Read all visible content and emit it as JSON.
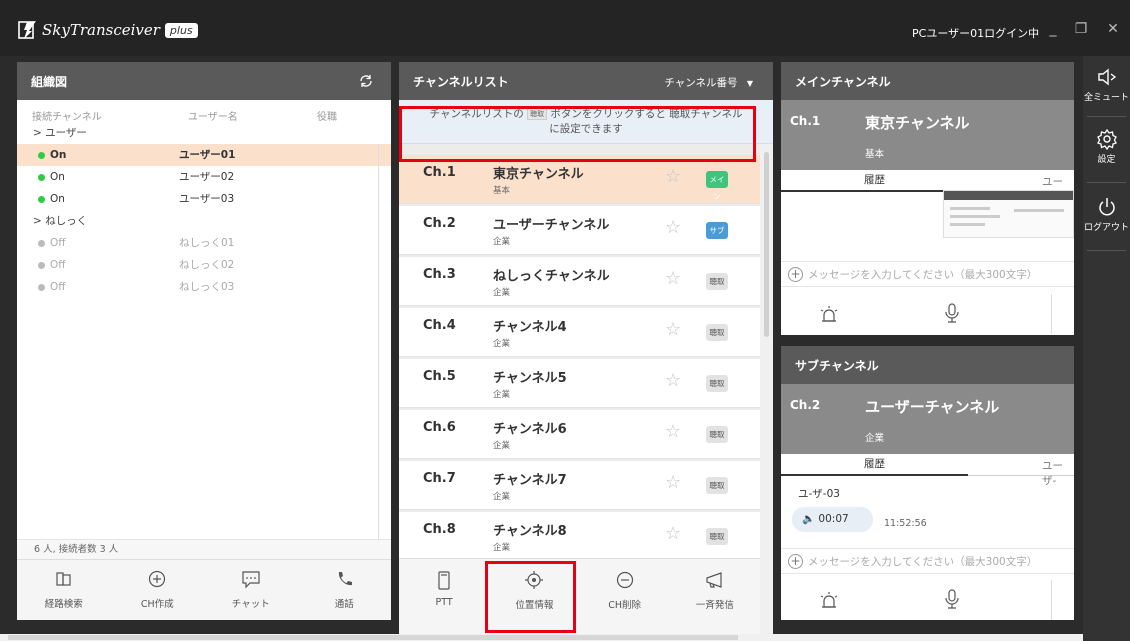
{
  "app": {
    "title": "SkyTransceiver",
    "edition": "plus",
    "login_status": "PCユーザー01ログイン中",
    "window_buttons": [
      "minimize-icon",
      "maximize-icon",
      "close-icon"
    ]
  },
  "org": {
    "title": "組織図",
    "columns": {
      "channel": "接続チャンネル",
      "user": "ユーザー名",
      "role": "役職"
    },
    "groups": [
      {
        "label": "ユーザー",
        "users": [
          {
            "status": "On",
            "name": "ユーザー01",
            "online": true,
            "selected": true
          },
          {
            "status": "On",
            "name": "ユーザー02",
            "online": true,
            "selected": false
          },
          {
            "status": "On",
            "name": "ユーザー03",
            "online": true,
            "selected": false
          }
        ]
      },
      {
        "label": "ねしっく",
        "users": [
          {
            "status": "Off",
            "name": "ねしっく01",
            "online": false,
            "selected": false
          },
          {
            "status": "Off",
            "name": "ねしっく02",
            "online": false,
            "selected": false
          },
          {
            "status": "Off",
            "name": "ねしっく03",
            "online": false,
            "selected": false
          }
        ]
      }
    ],
    "count_text": "6 人, 接続者数 3 人",
    "toolbar": [
      {
        "label": "経路検索",
        "icon": "route-search-icon"
      },
      {
        "label": "CH作成",
        "icon": "add-circle-icon"
      },
      {
        "label": "チャット",
        "icon": "chat-icon"
      },
      {
        "label": "通話",
        "icon": "phone-icon"
      }
    ]
  },
  "channel_list": {
    "title": "チャンネルリスト",
    "sort_label": "チャンネル番号",
    "hint_before": "チャンネルリストの",
    "hint_badge": "聴取",
    "hint_after": "ボタンをクリックすると 聴取チャンネル",
    "hint_line2": "に設定できます",
    "channels": [
      {
        "num": "Ch.1",
        "name": "東京チャンネル",
        "sub": "基本",
        "button": "メイン",
        "kind": "main",
        "active": true
      },
      {
        "num": "Ch.2",
        "name": "ユーザーチャンネル",
        "sub": "企業",
        "button": "サブ",
        "kind": "sub",
        "active": false
      },
      {
        "num": "Ch.3",
        "name": "ねしっくチャンネル",
        "sub": "企業",
        "button": "聴取",
        "kind": "listen",
        "active": false
      },
      {
        "num": "Ch.4",
        "name": "チャンネル4",
        "sub": "企業",
        "button": "聴取",
        "kind": "listen",
        "active": false
      },
      {
        "num": "Ch.5",
        "name": "チャンネル5",
        "sub": "企業",
        "button": "聴取",
        "kind": "listen",
        "active": false
      },
      {
        "num": "Ch.6",
        "name": "チャンネル6",
        "sub": "企業",
        "button": "聴取",
        "kind": "listen",
        "active": false
      },
      {
        "num": "Ch.7",
        "name": "チャンネル7",
        "sub": "企業",
        "button": "聴取",
        "kind": "listen",
        "active": false
      },
      {
        "num": "Ch.8",
        "name": "チャンネル8",
        "sub": "企業",
        "button": "聴取",
        "kind": "listen",
        "active": false
      }
    ],
    "toolbar": [
      {
        "label": "PTT",
        "icon": "ptt-device-icon"
      },
      {
        "label": "位置情報",
        "icon": "location-target-icon"
      },
      {
        "label": "CH削除",
        "icon": "remove-circle-icon"
      },
      {
        "label": "一斉発信",
        "icon": "megaphone-icon"
      }
    ]
  },
  "main_channel": {
    "title": "メインチャンネル",
    "num": "Ch.1",
    "name": "東京チャンネル",
    "sub": "基本",
    "tab_history": "履歴",
    "tab_user": "ユーザ-",
    "input_placeholder": "メッセージを入力してください（最大300文字）"
  },
  "sub_channel": {
    "title": "サブチャンネル",
    "num": "Ch.2",
    "name": "ユーザーチャンネル",
    "sub": "企業",
    "tab_history": "履歴",
    "tab_user": "ユーザ-",
    "message_user": "ユ-ザ-03",
    "voice_duration": "00:07",
    "voice_time": "11:52:56",
    "input_placeholder": "メッセージを入力してください（最大300文字）"
  },
  "rail": [
    {
      "label": "全ミュート",
      "icon": "speaker-mute-icon"
    },
    {
      "label": "設定",
      "icon": "gear-icon"
    },
    {
      "label": "ログアウト",
      "icon": "power-icon"
    }
  ],
  "colors": {
    "accent_main": "#3fc47d",
    "accent_sub": "#4a9cd6",
    "highlight": "#fbe1cc",
    "callout": "#e60012"
  }
}
